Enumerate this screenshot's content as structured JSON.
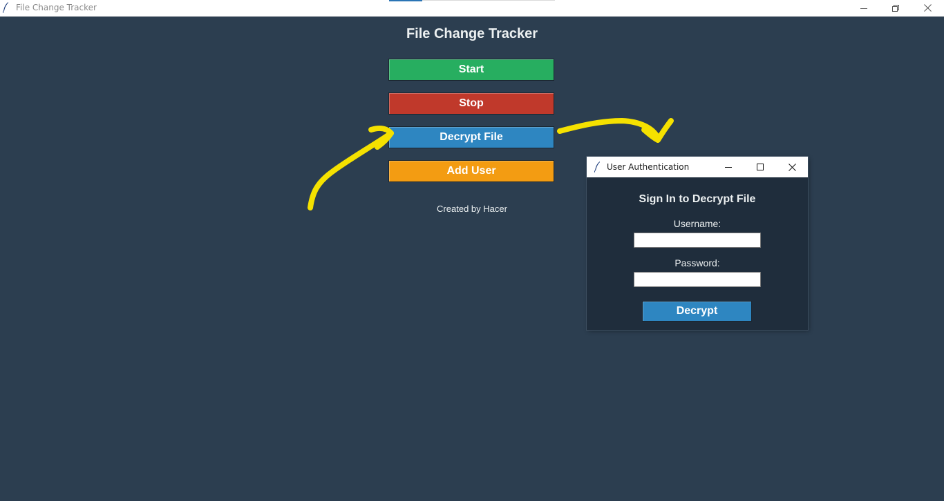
{
  "window": {
    "title": "File Change Tracker",
    "controls": {
      "minimize": "minimize-icon",
      "restore": "restore-icon",
      "close": "close-icon"
    }
  },
  "main": {
    "heading": "File Change Tracker",
    "buttons": {
      "start": "Start",
      "stop": "Stop",
      "decrypt": "Decrypt File",
      "add_user": "Add User"
    },
    "credit": "Created by Hacer"
  },
  "dialog": {
    "title": "User Authentication",
    "heading": "Sign In to Decrypt File",
    "username_label": "Username:",
    "username_value": "",
    "password_label": "Password:",
    "password_value": "",
    "submit_label": "Decrypt"
  },
  "colors": {
    "background": "#2c3e50",
    "dialog_background": "#1f2d3c",
    "start": "#27ae60",
    "stop": "#c0392b",
    "decrypt": "#2e86c1",
    "add_user": "#f39c12",
    "annotation": "#f5e100"
  }
}
